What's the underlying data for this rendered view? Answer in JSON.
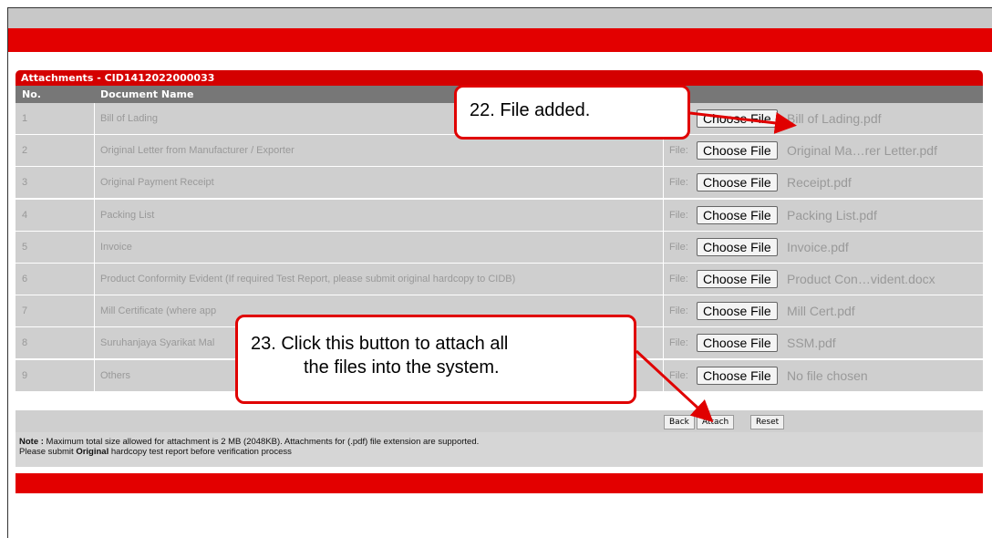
{
  "panel": {
    "title": "Attachments - CID1412022000033",
    "columns": {
      "no": "No.",
      "doc": "Document Name"
    }
  },
  "file_label": "File:",
  "choose_label": "Choose File",
  "rows": [
    {
      "no": "1",
      "doc": "Bill of Lading",
      "file": "Bill of Lading.pdf"
    },
    {
      "no": "2",
      "doc": "Original Letter from Manufacturer / Exporter",
      "file": "Original Ma…rer Letter.pdf"
    },
    {
      "no": "3",
      "doc": "Original Payment Receipt",
      "file": "Receipt.pdf"
    },
    {
      "no": "4",
      "doc": "Packing List",
      "file": "Packing List.pdf"
    },
    {
      "no": "5",
      "doc": "Invoice",
      "file": "Invoice.pdf"
    },
    {
      "no": "6",
      "doc": "Product Conformity Evident (If required Test Report, please submit original hardcopy to CIDB)",
      "file": "Product Con…vident.docx"
    },
    {
      "no": "7",
      "doc": "Mill Certificate (where app",
      "file": "Mill Cert.pdf"
    },
    {
      "no": "8",
      "doc": "Suruhanjaya Syarikat Mal",
      "file": "SSM.pdf"
    },
    {
      "no": "9",
      "doc": "Others",
      "file": "No file chosen"
    }
  ],
  "actions": {
    "back": "Back",
    "attach": "Attach",
    "reset": "Reset"
  },
  "note": {
    "label": "Note :",
    "line1": " Maximum total size allowed for attachment is 2 MB (2048KB). Attachments for (.pdf) file extension are supported.",
    "line2a": "Please submit ",
    "line2b": "Original",
    "line2c": " hardcopy test report before verification process"
  },
  "callouts": {
    "c22": "22.  File added.",
    "c23_line1": "23.  Click this button to attach all",
    "c23_line2": "the files into the system."
  },
  "colors": {
    "brand_red": "#e30000",
    "header_gray": "#777777",
    "row_gray": "#cfcfcf"
  }
}
